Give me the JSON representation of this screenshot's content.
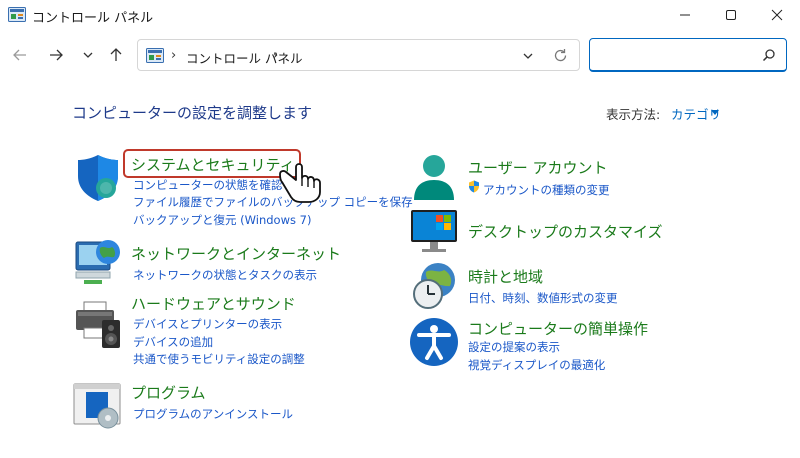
{
  "window": {
    "title": "コントロール パネル"
  },
  "navigation": {
    "address_crumb": "コントロール パネル",
    "chevron": "›",
    "search_value": "",
    "search_placeholder": ""
  },
  "header": {
    "heading": "コンピューターの設定を調整します",
    "view_by_label": "表示方法:",
    "view_by_value": "カテゴリ"
  },
  "categories": [
    {
      "title": "システムとセキュリティ",
      "icon": "shield-icon",
      "links": [
        "コンピューターの状態を確認",
        "ファイル履歴でファイルのバックアップ コピーを保存",
        "バックアップと復元 (Windows 7)"
      ]
    },
    {
      "title": "ネットワークとインターネット",
      "icon": "network-globe-icon",
      "links": [
        "ネットワークの状態とタスクの表示"
      ]
    },
    {
      "title": "ハードウェアとサウンド",
      "icon": "printer-speaker-icon",
      "links": [
        "デバイスとプリンターの表示",
        "デバイスの追加",
        "共通で使うモビリティ設定の調整"
      ]
    },
    {
      "title": "プログラム",
      "icon": "programs-icon",
      "links": [
        "プログラムのアンインストール"
      ]
    },
    {
      "title": "ユーザー アカウント",
      "icon": "user-icon",
      "links": [
        "アカウントの種類の変更"
      ]
    },
    {
      "title": "デスクトップのカスタマイズ",
      "icon": "monitor-icon",
      "links": []
    },
    {
      "title": "時計と地域",
      "icon": "clock-globe-icon",
      "links": [
        "日付、時刻、数値形式の変更"
      ]
    },
    {
      "title": "コンピューターの簡単操作",
      "icon": "accessibility-icon",
      "links": [
        "設定の提案の表示",
        "視覚ディスプレイの最適化"
      ]
    }
  ],
  "colors": {
    "heading": "#1e3a8a",
    "category_title": "#1a7a1a",
    "link": "#1a57c8",
    "accent": "#0067c0",
    "highlight": "#c0392b"
  }
}
